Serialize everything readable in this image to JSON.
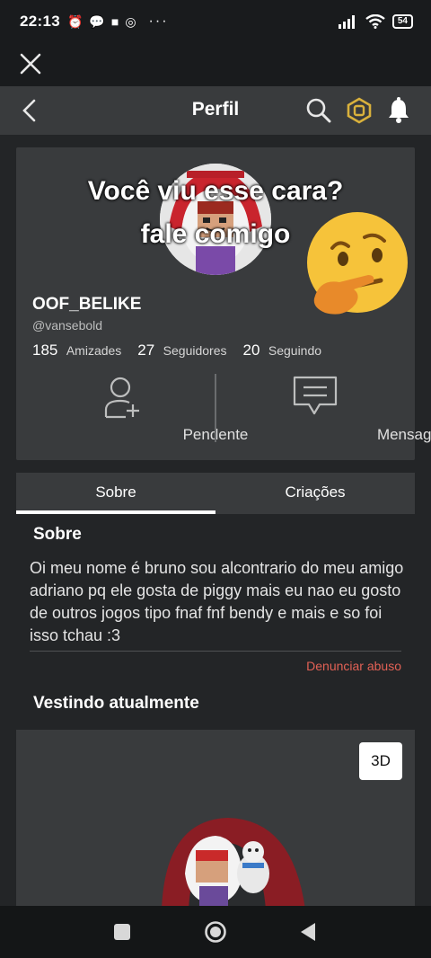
{
  "status_bar": {
    "time": "22:13",
    "battery": "54",
    "more": "···"
  },
  "nav": {
    "title": "Perfil"
  },
  "profile": {
    "overlay_line1": "Você viu esse cara?",
    "overlay_line2": "fale comigo",
    "username": "OOF_BELIKE",
    "handle": "@vansebold",
    "stats": [
      {
        "count": "185",
        "label": "Amizades"
      },
      {
        "count": "27",
        "label": "Seguidores"
      },
      {
        "count": "20",
        "label": "Seguindo"
      }
    ],
    "actions": {
      "pending": "Pendente",
      "message": "Mensagem"
    }
  },
  "tabs": [
    {
      "label": "Sobre"
    },
    {
      "label": "Criações"
    }
  ],
  "about": {
    "title": "Sobre",
    "text": "Oi meu nome é bruno sou alcontrario do meu amigo adriano pq ele gosta de piggy mais eu nao eu gosto de outros jogos tipo fnaf fnf bendy e mais e so foi isso tchau :3",
    "report": "Denunciar abuso"
  },
  "wearing": {
    "title": "Vestindo atualmente",
    "button_3d": "3D"
  },
  "colors": {
    "background": "#232527",
    "card": "#393b3d",
    "report": "#e26155"
  }
}
